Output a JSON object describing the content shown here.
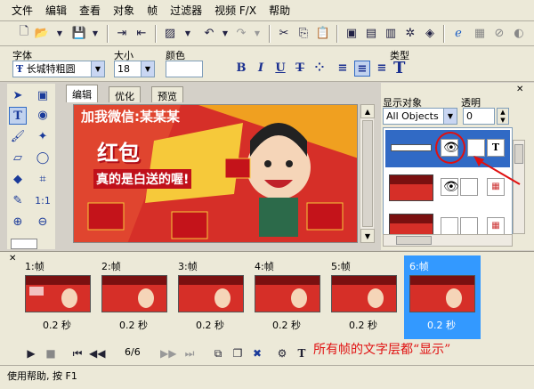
{
  "menu": [
    "文件",
    "编辑",
    "查看",
    "对象",
    "帧",
    "过滤器",
    "视频 F/X",
    "帮助"
  ],
  "props": {
    "font_label": "字体",
    "font_value": "长城特粗圆",
    "size_label": "大小",
    "size_value": "18",
    "color_label": "颜色",
    "type_label": "类型"
  },
  "format_buttons": [
    "B",
    "I",
    "U",
    "T"
  ],
  "editor_tabs": [
    "编辑",
    "优化",
    "预览"
  ],
  "canvas": {
    "headline": "加我微信:某某某",
    "text1": "红包",
    "text2": "真的是白送的喔!"
  },
  "right_panel": {
    "display_label": "显示对象",
    "display_value": "All Objects",
    "transparency_label": "透明",
    "transparency_value": "0"
  },
  "frames": [
    {
      "label": "1:帧",
      "time": "0.2 秒"
    },
    {
      "label": "2:帧",
      "time": "0.2 秒"
    },
    {
      "label": "3:帧",
      "time": "0.2 秒"
    },
    {
      "label": "4:帧",
      "time": "0.2 秒"
    },
    {
      "label": "5:帧",
      "time": "0.2 秒"
    },
    {
      "label": "6:帧",
      "time": "0.2 秒"
    }
  ],
  "frame_mini_title": "加我微信:某某某",
  "frame_mini_text": "红包",
  "playback": {
    "counter": "6/6"
  },
  "annotation": "所有帧的文字层都“显示”",
  "status": "使用帮助, 按 F1"
}
